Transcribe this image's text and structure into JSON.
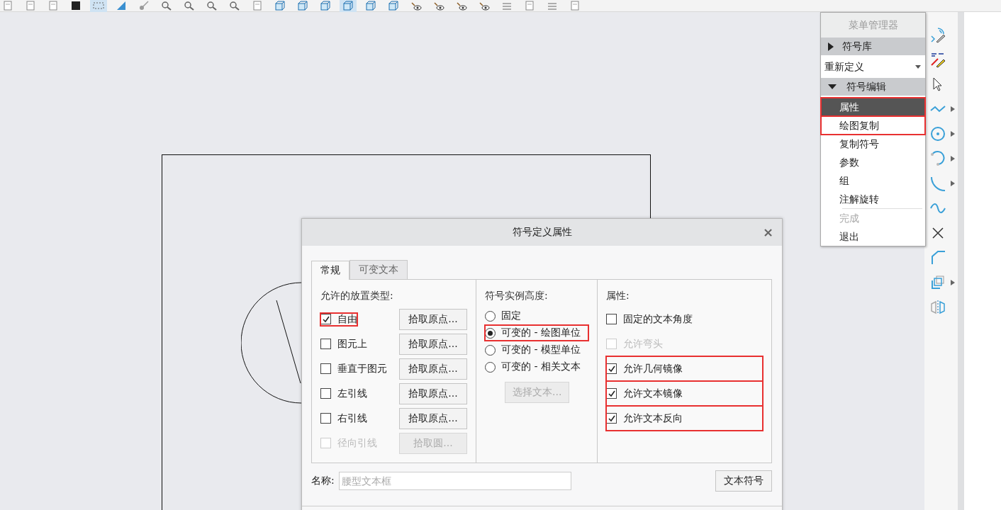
{
  "toolbar": [
    {
      "kind": "page",
      "selected": false
    },
    {
      "kind": "page",
      "selected": false
    },
    {
      "kind": "page",
      "selected": false
    },
    {
      "kind": "dark",
      "selected": false
    },
    {
      "kind": "dashed",
      "selected": true
    },
    {
      "kind": "slope",
      "selected": false
    },
    {
      "kind": "pin",
      "selected": false
    },
    {
      "kind": "magnifier",
      "selected": false
    },
    {
      "kind": "magnifier",
      "selected": false
    },
    {
      "kind": "magnifier",
      "selected": false
    },
    {
      "kind": "magnifier",
      "selected": false
    },
    {
      "kind": "page",
      "selected": false
    },
    {
      "kind": "cube",
      "selected": false
    },
    {
      "kind": "cube",
      "selected": false
    },
    {
      "kind": "cube",
      "selected": false
    },
    {
      "kind": "cube",
      "selected": true
    },
    {
      "kind": "cube",
      "selected": false
    },
    {
      "kind": "cube",
      "selected": false
    },
    {
      "kind": "eye",
      "selected": false
    },
    {
      "kind": "eye",
      "selected": false
    },
    {
      "kind": "eye",
      "selected": false
    },
    {
      "kind": "eye",
      "selected": false
    },
    {
      "kind": "lines",
      "selected": false
    },
    {
      "kind": "page",
      "selected": false
    },
    {
      "kind": "lines",
      "selected": false
    },
    {
      "kind": "page",
      "selected": false
    }
  ],
  "menu_manager": {
    "title": "菜单管理器",
    "items": [
      {
        "kind": "section",
        "label": "符号库",
        "expanded": false,
        "highlighted": false
      },
      {
        "kind": "dropdown",
        "label": "重新定义",
        "highlighted": false
      },
      {
        "kind": "section",
        "label": "符号编辑",
        "expanded": true,
        "highlighted": false
      },
      {
        "kind": "item",
        "label": "属性",
        "selected": true,
        "disabled": false,
        "highlighted": true
      },
      {
        "kind": "item",
        "label": "绘图复制",
        "selected": false,
        "disabled": false,
        "highlighted": true
      },
      {
        "kind": "item",
        "label": "复制符号",
        "selected": false,
        "disabled": false,
        "highlighted": false
      },
      {
        "kind": "item",
        "label": "参数",
        "selected": false,
        "disabled": false,
        "highlighted": false
      },
      {
        "kind": "item",
        "label": "组",
        "selected": false,
        "disabled": false,
        "highlighted": false
      },
      {
        "kind": "item",
        "label": "注解旋转",
        "selected": false,
        "disabled": false,
        "highlighted": false
      },
      {
        "kind": "divider"
      },
      {
        "kind": "item",
        "label": "完成",
        "selected": false,
        "disabled": true,
        "highlighted": false
      },
      {
        "kind": "item",
        "label": "退出",
        "selected": false,
        "disabled": false,
        "highlighted": false
      }
    ]
  },
  "side_tools": [
    {
      "kind": "dimension",
      "flyout": false
    },
    {
      "kind": "palette",
      "flyout": false
    },
    {
      "kind": "cursor",
      "flyout": false
    },
    {
      "kind": "zigzag",
      "flyout": true
    },
    {
      "kind": "circle",
      "flyout": true
    },
    {
      "kind": "arc",
      "flyout": true
    },
    {
      "kind": "fillet",
      "flyout": true
    },
    {
      "kind": "spline",
      "flyout": false
    },
    {
      "kind": "cross",
      "flyout": false
    },
    {
      "kind": "chamfer",
      "flyout": false
    },
    {
      "kind": "copy",
      "flyout": true
    },
    {
      "kind": "mirror",
      "flyout": false
    }
  ],
  "dialog": {
    "title": "符号定义属性",
    "close": "×",
    "tabs": [
      {
        "label": "常规",
        "selected": true
      },
      {
        "label": "可变文本",
        "selected": false
      }
    ],
    "placement": {
      "heading": "允许的放置类型:",
      "rows": [
        {
          "label": "自由",
          "checked": true,
          "disabled": false,
          "highlighted": true,
          "button": "拾取原点...",
          "button_disabled": false
        },
        {
          "label": "图元上",
          "checked": false,
          "disabled": false,
          "highlighted": false,
          "button": "拾取原点...",
          "button_disabled": false
        },
        {
          "label": "垂直于图元",
          "checked": false,
          "disabled": false,
          "highlighted": false,
          "button": "拾取原点...",
          "button_disabled": false
        },
        {
          "label": "左引线",
          "checked": false,
          "disabled": false,
          "highlighted": false,
          "button": "拾取原点...",
          "button_disabled": false
        },
        {
          "label": "右引线",
          "checked": false,
          "disabled": false,
          "highlighted": false,
          "button": "拾取原点...",
          "button_disabled": false
        },
        {
          "label": "径向引线",
          "checked": false,
          "disabled": true,
          "highlighted": false,
          "button": "拾取圆...",
          "button_disabled": true
        }
      ]
    },
    "height": {
      "heading": "符号实例高度:",
      "options": [
        {
          "label": "固定",
          "selected": false,
          "highlighted": false
        },
        {
          "label": "可变的 - 绘图单位",
          "selected": true,
          "highlighted": true
        },
        {
          "label": "可变的 - 模型单位",
          "selected": false,
          "highlighted": false
        },
        {
          "label": "可变的 - 相关文本",
          "selected": false,
          "highlighted": false
        }
      ],
      "button": "选择文本...",
      "button_disabled": true
    },
    "attributes": {
      "heading": "属性:",
      "options": [
        {
          "label": "固定的文本角度",
          "checked": false,
          "disabled": false,
          "highlighted": false
        },
        {
          "label": "允许弯头",
          "checked": false,
          "disabled": true,
          "highlighted": false
        },
        {
          "label": "允许几何镜像",
          "checked": true,
          "disabled": false,
          "highlighted": true
        },
        {
          "label": "允许文本镜像",
          "checked": true,
          "disabled": false,
          "highlighted": true
        },
        {
          "label": "允许文本反向",
          "checked": true,
          "disabled": false,
          "highlighted": true
        }
      ]
    },
    "name_label": "名称:",
    "name_placeholder": "腰型文本框",
    "text_symbol_button": "文本符号"
  }
}
